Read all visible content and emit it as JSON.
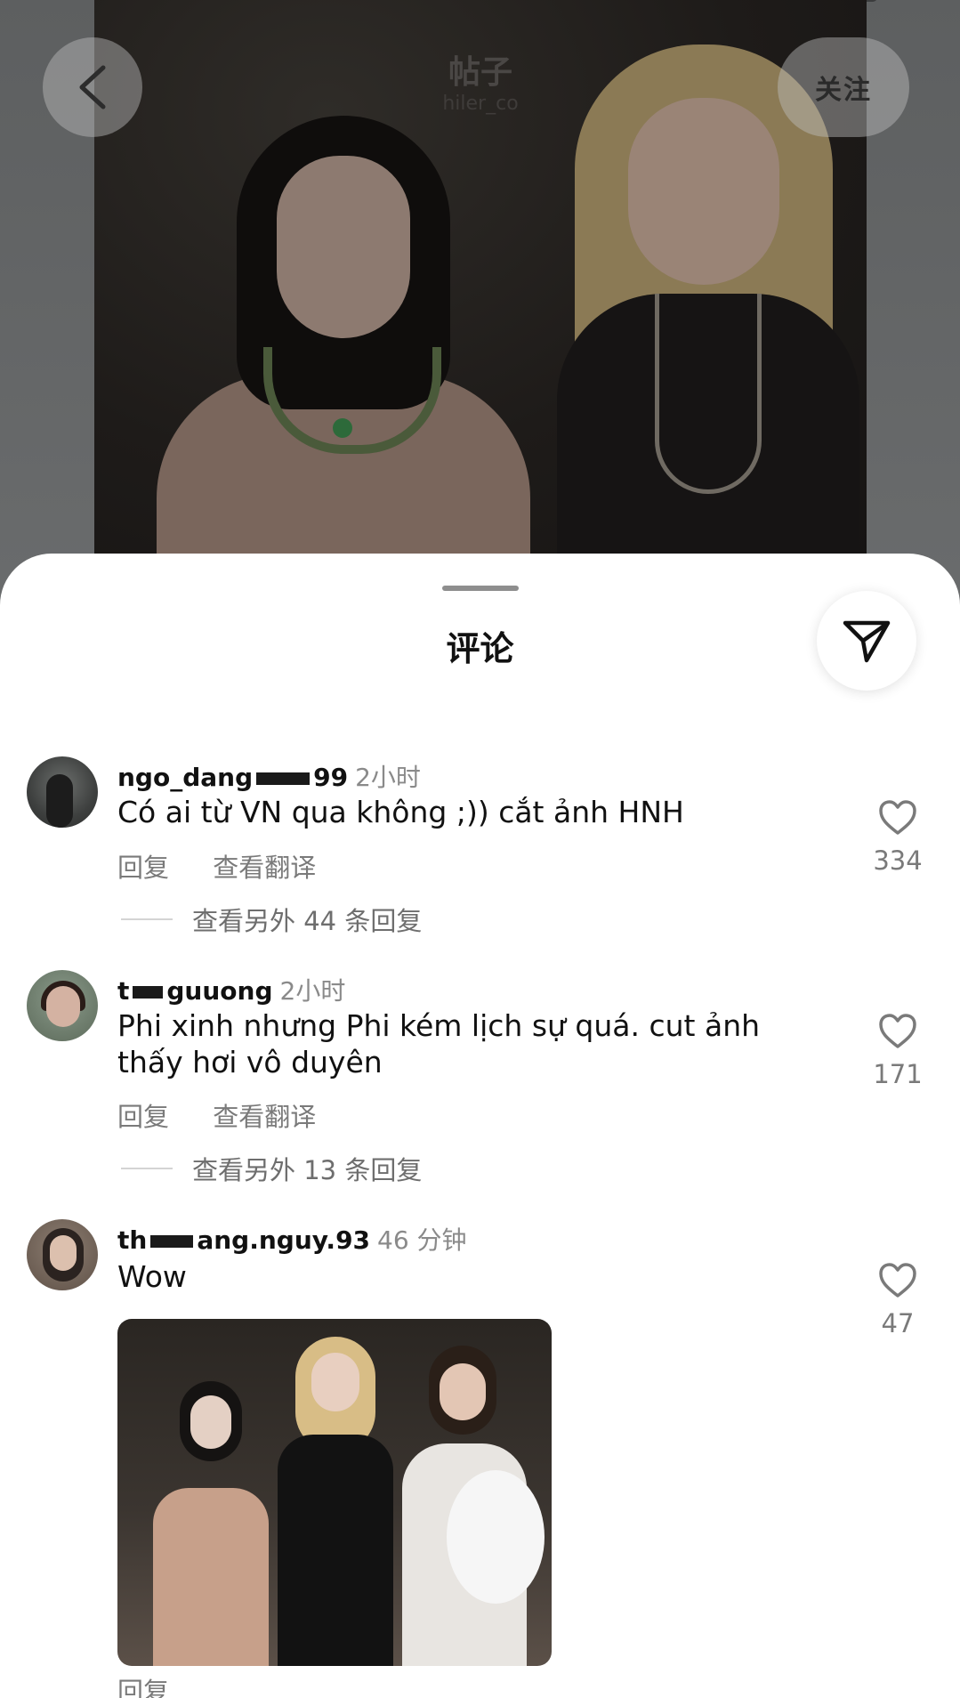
{
  "status_bar": {},
  "post": {
    "header_title": "帖子",
    "header_subtitle": "hiler_co",
    "follow_label": "关注"
  },
  "sheet": {
    "title": "评论"
  },
  "comments": [
    {
      "username_prefix": "ngo_dang",
      "username_suffix": "99",
      "time": "2小时",
      "text": "Có ai từ VN qua không ;)) cắt ảnh HNH",
      "reply_label": "回复",
      "translate_label": "查看翻译",
      "more_replies": "查看另外 44 条回复",
      "likes": "334"
    },
    {
      "username_prefix": "t",
      "username_suffix": "guuong",
      "time": "2小时",
      "text": "Phi xinh nhưng Phi kém lịch sự quá. cut ảnh thấy hơi vô duyên",
      "reply_label": "回复",
      "translate_label": "查看翻译",
      "more_replies": "查看另外 13 条回复",
      "likes": "171"
    },
    {
      "username_prefix": "th",
      "username_suffix": "ang.nguy.93",
      "time": "46 分钟",
      "text": "Wow",
      "reply_label": "回复",
      "likes": "47"
    }
  ],
  "icons": {
    "back": "chevron-left-icon",
    "share": "send-icon",
    "like": "heart-icon"
  },
  "colors": {
    "sheet_bg": "#ffffff",
    "muted_text": "#7a7a7a",
    "primary_text": "#111111"
  }
}
